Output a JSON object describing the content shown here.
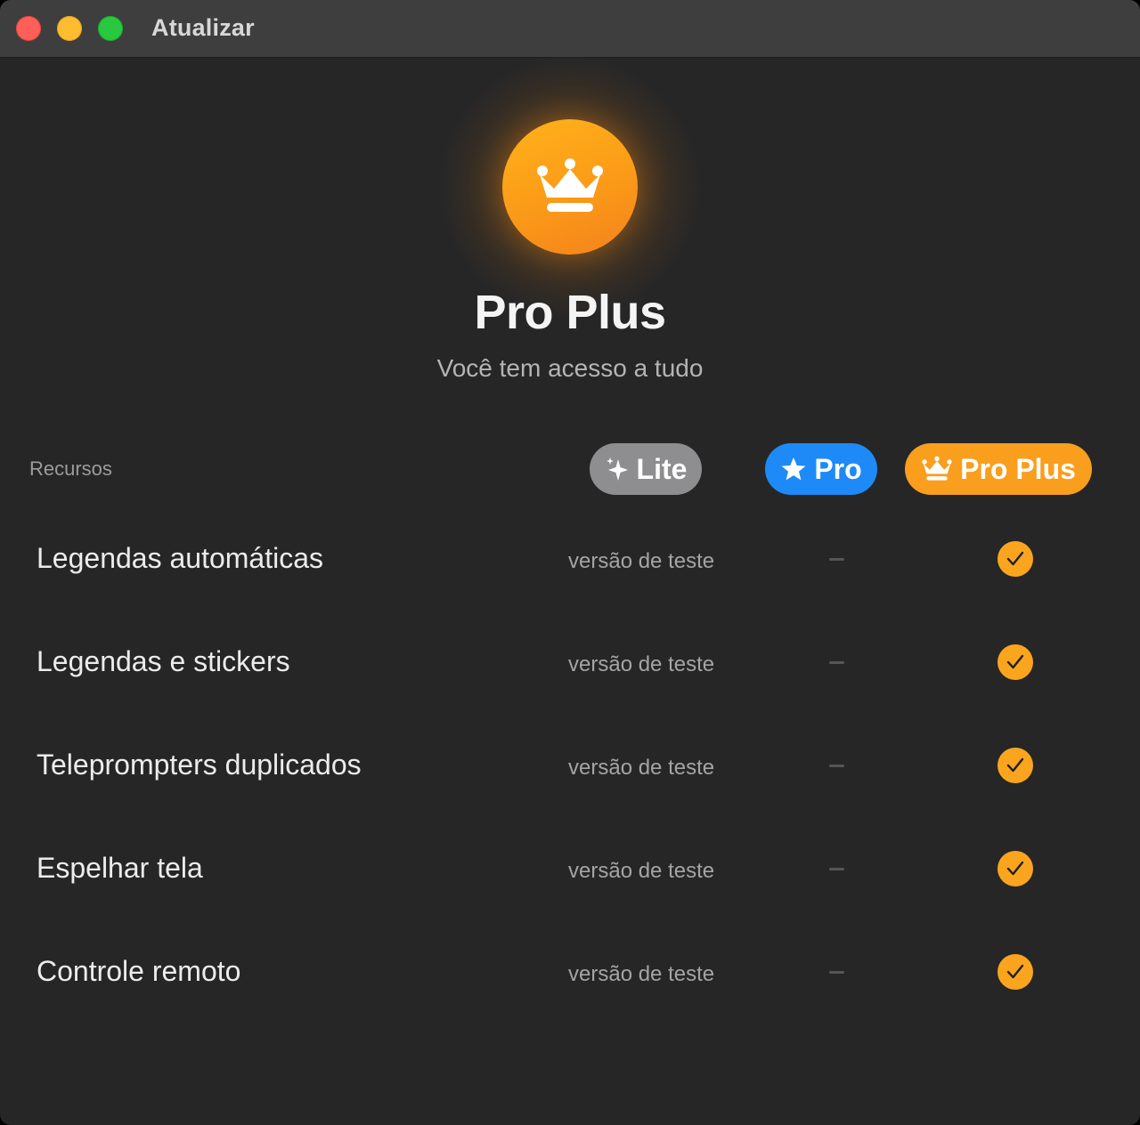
{
  "window": {
    "title": "Atualizar"
  },
  "hero": {
    "icon": "crown-icon",
    "title": "Pro Plus",
    "subtitle": "Você tem acesso a tudo"
  },
  "table": {
    "features_label": "Recursos",
    "columns": [
      {
        "label": "Lite",
        "icon": "sparkles-icon",
        "color": "#8e8e90"
      },
      {
        "label": "Pro",
        "icon": "star-icon",
        "color": "#1d8af7"
      },
      {
        "label": "Pro Plus",
        "icon": "crown-icon",
        "color": "#fa9e1d"
      }
    ],
    "rows": [
      {
        "feature": "Legendas automáticas",
        "lite": "versão de teste",
        "pro": "–",
        "proplus": "check"
      },
      {
        "feature": "Legendas e stickers",
        "lite": "versão de teste",
        "pro": "–",
        "proplus": "check"
      },
      {
        "feature": "Teleprompters duplicados",
        "lite": "versão de teste",
        "pro": "–",
        "proplus": "check"
      },
      {
        "feature": "Espelhar tela",
        "lite": "versão de teste",
        "pro": "–",
        "proplus": "check"
      },
      {
        "feature": "Controle remoto",
        "lite": "versão de teste",
        "pro": "–",
        "proplus": "check"
      }
    ]
  },
  "colors": {
    "background": "#262627",
    "titlebar": "#3e3e3f",
    "accent": "#fa9e1d",
    "pro_blue": "#1d8af7",
    "lite_gray": "#8e8e90"
  }
}
